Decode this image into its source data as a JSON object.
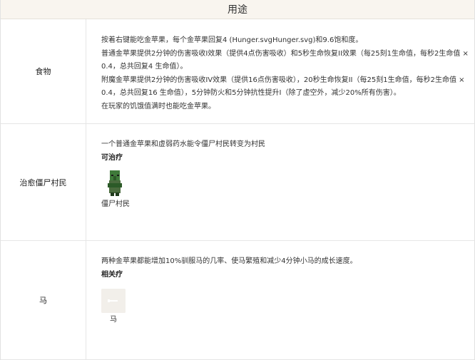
{
  "header": {
    "title": "用途"
  },
  "rows": [
    {
      "label": "食物",
      "lines": [
        "按着右键能吃金苹果，每个金苹果回复4 (Hunger.svgHunger.svg)和9.6饱和度。",
        "普通金苹果提供2分钟的伤害吸收I效果（提供4点伤害吸收）和5秒生命恢复II效果（每25刻1生命值，每秒2生命值 ×",
        "0.4，总共回复4 生命值）。",
        "附魔金苹果提供2分钟的伤害吸收IV效果（提供16点伤害吸收），20秒生命恢复II（每25刻1生命值，每秒2生命值 ×",
        "0.4，总共回复16 生命值），5分钟防火和5分钟抗性提升I（除了虚空外，减少20%所有伤害）。",
        "在玩家的饥饿值满时也能吃金苹果。"
      ]
    },
    {
      "label": "治愈僵尸村民",
      "description": "一个普通金苹果和虚弱药水能令僵尸村民转变为村民",
      "subheading": "可治疗",
      "mob": {
        "name": "僵尸村民",
        "icon": "zombie-villager-icon",
        "colors": {
          "skin": "#3f7a3a",
          "skin_dark": "#2c5a28",
          "robe": "#4a6b3e",
          "shadow": "#1f3a1c"
        }
      }
    },
    {
      "label": "马",
      "description": "两种金苹果都能增加10%驯服马的几率、使马繁殖和减少4分钟小马的成长速度。",
      "subheading": "相关疗",
      "mob": {
        "name": "马",
        "icon": "horse-icon",
        "colors": {
          "frame": "#f2efea",
          "glyph": "#ffffff"
        }
      }
    }
  ]
}
